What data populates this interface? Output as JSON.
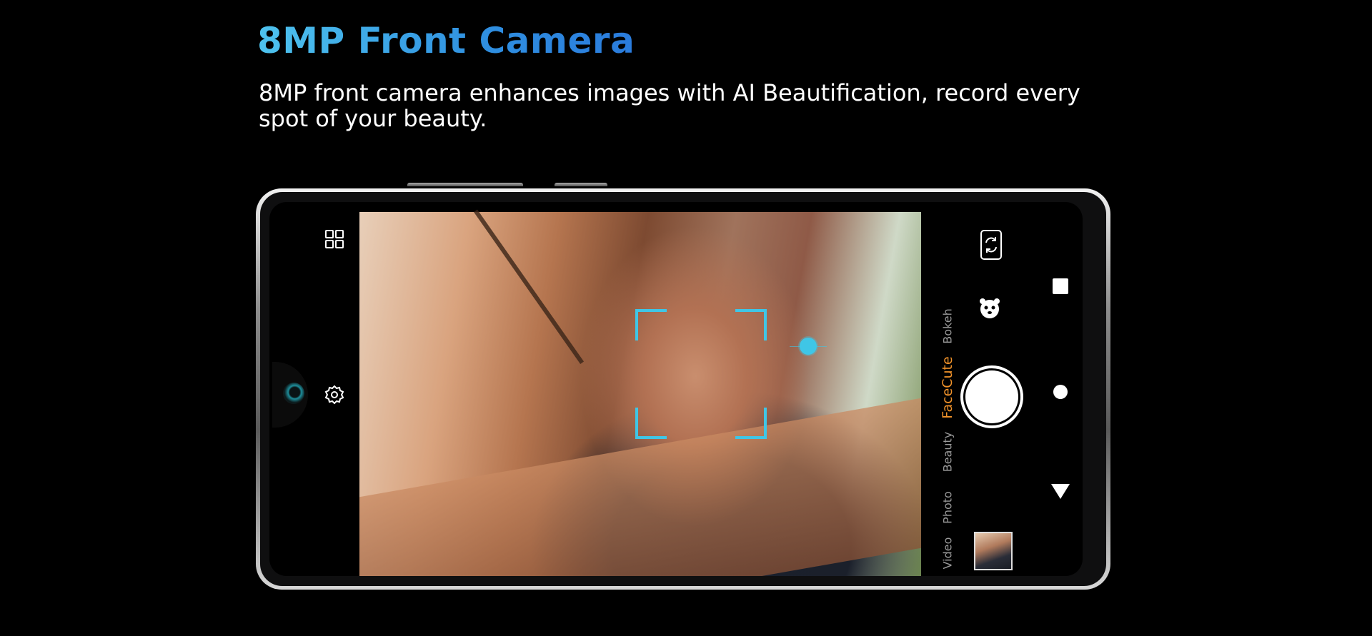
{
  "header": {
    "title": "8MP Front Camera",
    "subtitle": "8MP front camera enhances images with AI Beautification, record every spot of your beauty."
  },
  "camera_app": {
    "left_controls": [
      {
        "icon": "grid-menu-icon"
      },
      {
        "icon": "settings-gear-icon"
      }
    ],
    "right_controls": {
      "switch_camera_icon": "switch-camera-icon",
      "sticker_icon": "sticker-face-icon"
    },
    "modes": [
      {
        "label": "Video",
        "active": false
      },
      {
        "label": "Photo",
        "active": false
      },
      {
        "label": "Beauty",
        "active": false
      },
      {
        "label": "FaceCute",
        "active": true
      },
      {
        "label": "Bokeh",
        "active": false
      }
    ],
    "accent_color": "#3fc6e6",
    "active_mode_color": "#f0922a"
  },
  "system_nav": {
    "recents": "square-recents-icon",
    "home": "circle-home-icon",
    "back": "triangle-back-icon"
  }
}
